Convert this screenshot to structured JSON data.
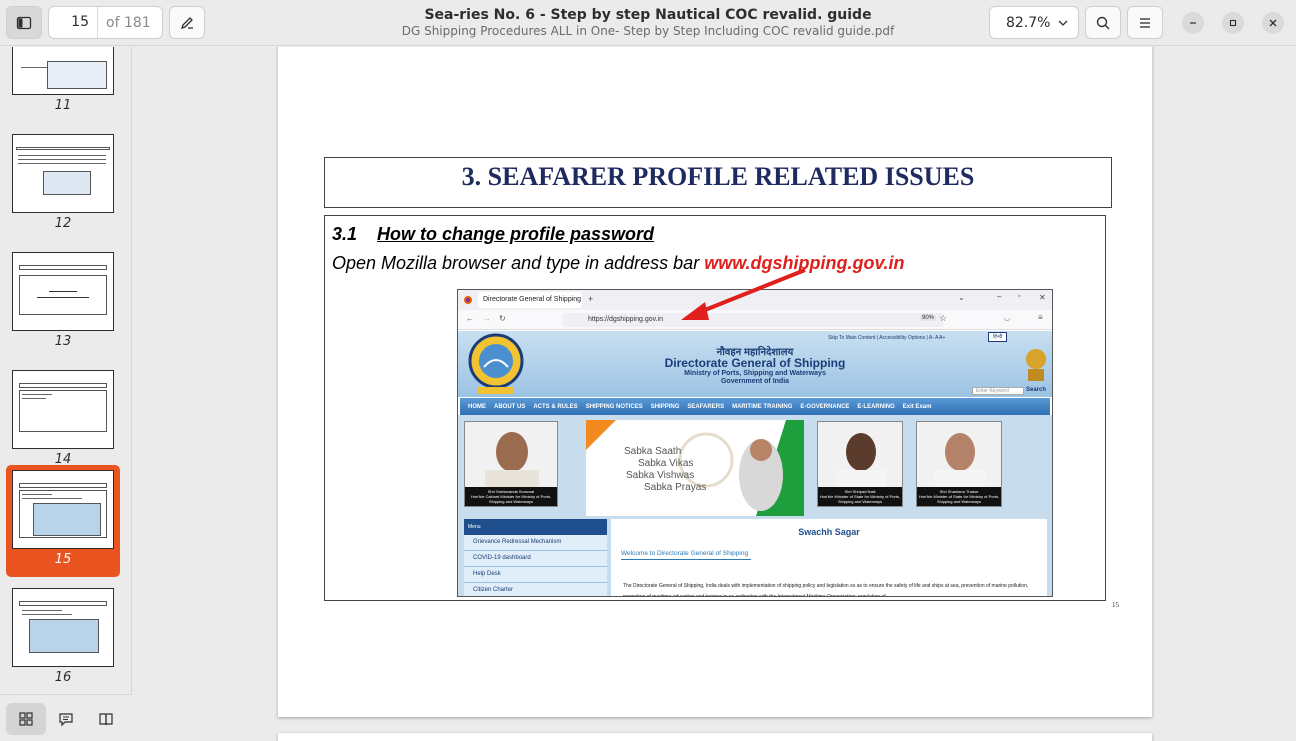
{
  "toolbar": {
    "current_page": "15",
    "of_pages": "of 181",
    "title": "Sea-ries No. 6 - Step by step Nautical COC revalid. guide",
    "filename": "DG Shipping Procedures ALL in One- Step by Step Including COC revalid guide.pdf",
    "zoom": "82.7%"
  },
  "thumbnails": [
    {
      "label": "11",
      "selected": false
    },
    {
      "label": "12",
      "selected": false
    },
    {
      "label": "13",
      "selected": false
    },
    {
      "label": "14",
      "selected": false
    },
    {
      "label": "15",
      "selected": true
    },
    {
      "label": "16",
      "selected": false
    }
  ],
  "document": {
    "heading": "3. SEAFARER PROFILE RELATED ISSUES",
    "section_number": "3.1",
    "section_title": "How to change profile password",
    "instruction": "Open Mozilla browser and type in address bar ",
    "instruction_url": "www.dgshipping.gov.in",
    "page_number": "15"
  },
  "screenshot": {
    "tab_title": "Directorate General of Shipping | G",
    "address": "https://dgshipping.gov.in",
    "zoom": "90%",
    "top_links": "Skip To Main Content | Accessibility Options | A- A A+",
    "lang": "हिन्दी",
    "hindi_name": "नौवहन महानिदेशालय",
    "site_name": "Directorate General of Shipping",
    "ministry": "Ministry of Ports, Shipping and Waterways",
    "gov": "Government of India",
    "search_placeholder": "Enter Keyword",
    "search_button": "Search",
    "nav": [
      "HOME",
      "ABOUT US",
      "ACTS & RULES",
      "SHIPPING NOTICES",
      "SHIPPING",
      "SEAFARERS",
      "MARITIME TRAINING",
      "E-GOVERNANCE",
      "E-LEARNING",
      "Exit Exam"
    ],
    "banner_lines": [
      "Sabka Saath",
      "Sabka Vikas",
      "Sabka Vishwas",
      "Sabka Prayas"
    ],
    "minister1_name": "Shri Sarbananda Sonowal",
    "minister1_role": "Hon'ble Cabinet Minister for Ministry of Ports, Shipping and Waterways",
    "minister2_name": "Shri Shripad Naik",
    "minister2_role": "Hon'ble Minister of State for Ministry of Ports, Shipping and Waterways",
    "minister3_name": "Shri Shantanu Thakur",
    "minister3_role": "Hon'ble Minister of State for Ministry of Ports, Shipping and Waterways",
    "menu_head": "Menu",
    "menu": [
      "Grievance Redressal Mechanism",
      "COVID-19 dashboard",
      "Help Desk",
      "Citizen Charter"
    ],
    "swachh": "Swachh Sagar",
    "welcome": "Welcome to Directorate General of Shipping",
    "body_text": "The Directorate General of Shipping, India deals with implementation of shipping policy and legislation so as to ensure the safety of life and ships at sea, prevention of marine pollution, promotion of maritime education and training in co-ordination with the International Maritime Organization, regulation of"
  },
  "colors": {
    "accent": "#e95420",
    "url_red": "#e0201c",
    "heading_navy": "#1f2a60"
  }
}
